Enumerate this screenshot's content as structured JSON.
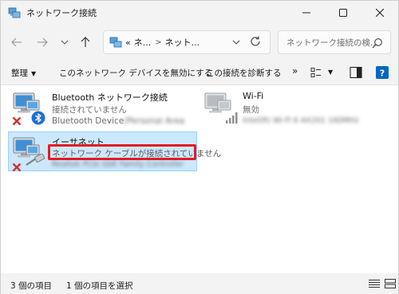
{
  "window": {
    "title": "ネットワーク接続"
  },
  "address": {
    "prefix": "«",
    "crumb1": "ネ...",
    "separator": ">",
    "crumb2": "ネット..."
  },
  "search": {
    "placeholder": "ネットワーク接続の検..."
  },
  "commands": {
    "organize": "整理",
    "disable": "このネットワーク デバイスを無効にする",
    "diagnose": "この接続を診断する",
    "more": "»"
  },
  "items": [
    {
      "name": "Bluetooth ネットワーク接続",
      "status": "接続されていません",
      "device": "Bluetooth Device",
      "device_suffix": "(Personal Area"
    },
    {
      "name": "Wi-Fi",
      "status": "無効",
      "device": "Intel(R) Wi-Fi 6 AX201 160MHz"
    },
    {
      "name": "イーサネット",
      "status": "ネットワーク ケーブルが接続されていません",
      "device": "Realtek PCIe GbE Family Controller"
    }
  ],
  "status": {
    "count": "3 個の項目",
    "selected": "1 個の項目を選択"
  },
  "colors": {
    "accent": "#0067c0",
    "selection": "#cce8ff",
    "highlight": "#e31b23",
    "error": "#d32f2f"
  }
}
